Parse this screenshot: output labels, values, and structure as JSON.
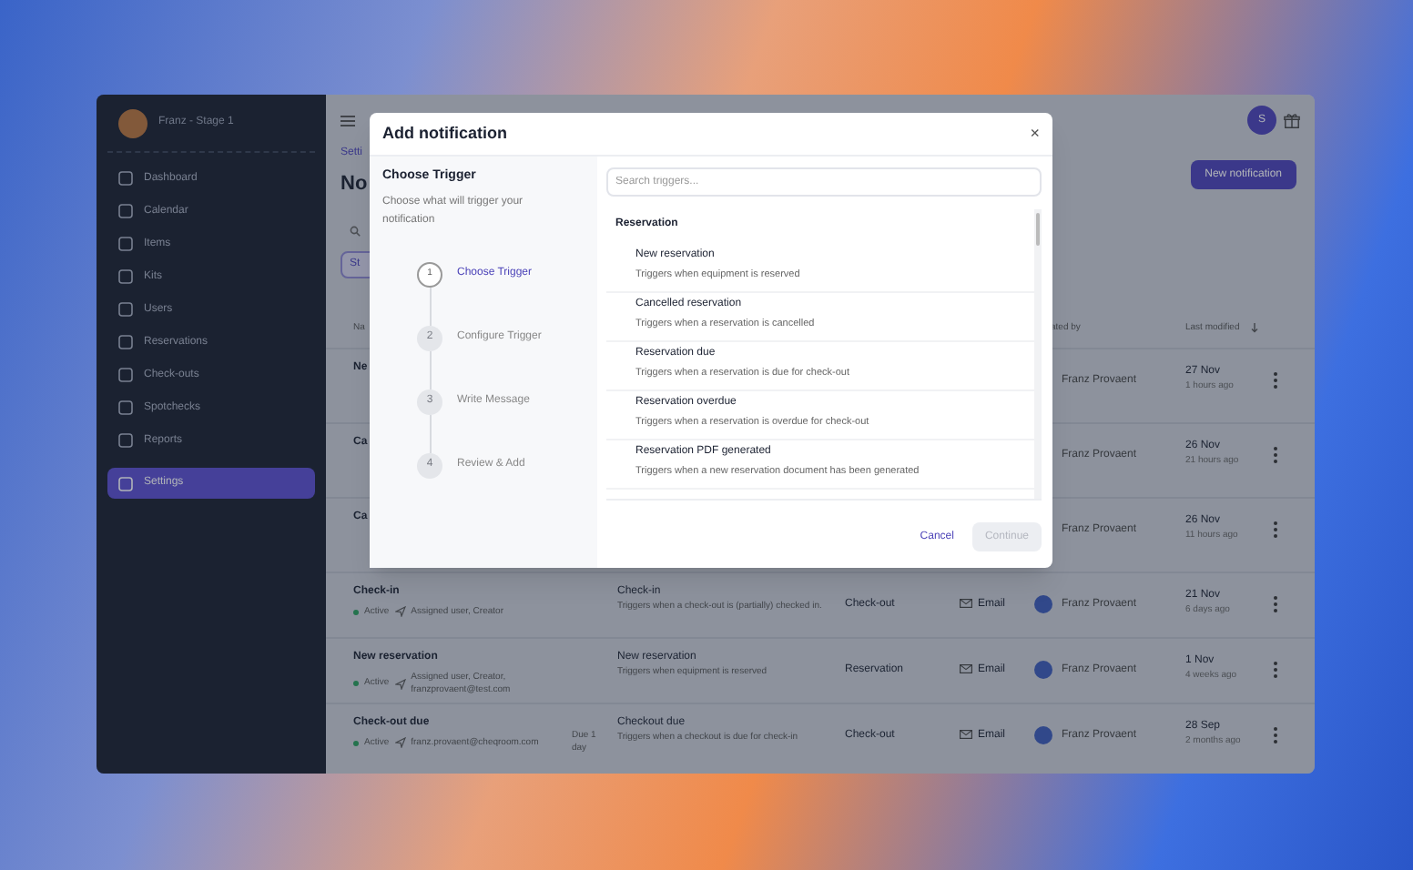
{
  "workspace": {
    "name": "Franz - Stage 1"
  },
  "sidebar": {
    "items": [
      {
        "label": "Dashboard",
        "selected": false
      },
      {
        "label": "Calendar",
        "selected": false
      },
      {
        "label": "Items",
        "selected": false
      },
      {
        "label": "Kits",
        "selected": false
      },
      {
        "label": "Users",
        "selected": false
      },
      {
        "label": "Reservations",
        "selected": false
      },
      {
        "label": "Check-outs",
        "selected": false
      },
      {
        "label": "Spotchecks",
        "selected": false
      },
      {
        "label": "Reports",
        "selected": false
      },
      {
        "label": "Settings",
        "selected": true
      }
    ]
  },
  "topbar": {
    "avatar": "S"
  },
  "page": {
    "breadcrumb": "Setti",
    "heading": "No",
    "filter": "St",
    "new_button": "New notification"
  },
  "table": {
    "columns": [
      {
        "label": "Na"
      },
      {
        "label": "ated by"
      },
      {
        "label": "Last modified",
        "sorted": true
      }
    ],
    "rows": [
      {
        "name": "Ne",
        "creator": "Franz Provaent",
        "date": "27 Nov",
        "ago": "1 hours ago"
      },
      {
        "name": "Ca",
        "creator": "Franz Provaent",
        "date": "26 Nov",
        "ago": "21 hours ago"
      },
      {
        "name": "Ca",
        "creator": "Franz Provaent",
        "date": "26 Nov",
        "ago": "11 hours ago"
      },
      {
        "name": "Check-in",
        "status": "Active",
        "recipients": "Assigned user, Creator",
        "trigger": "Check-in",
        "trigger_desc": "Triggers when a check-out is (partially) checked in.",
        "category": "Check-out",
        "channel": "Email",
        "creator": "Franz Provaent",
        "date": "21 Nov",
        "ago": "6 days ago"
      },
      {
        "name": "New reservation",
        "status": "Active",
        "recipients": "Assigned user, Creator, franzprovaent@test.com",
        "trigger": "New reservation",
        "trigger_desc": "Triggers when equipment is reserved",
        "category": "Reservation",
        "channel": "Email",
        "creator": "Franz Provaent",
        "date": "1 Nov",
        "ago": "4 weeks ago"
      },
      {
        "name": "Check-out due",
        "status": "Active",
        "recipients": "franz.provaent@cheqroom.com",
        "due": "Due 1 day",
        "trigger": "Checkout due",
        "trigger_desc": "Triggers when a checkout is due for check-in",
        "category": "Check-out",
        "channel": "Email",
        "creator": "Franz Provaent",
        "date": "28 Sep",
        "ago": "2 months ago"
      }
    ]
  },
  "modal": {
    "title": "Add notification",
    "close": "×",
    "section_title": "Choose Trigger",
    "section_desc": "Choose what will trigger your notification",
    "steps": [
      {
        "number": "1",
        "label": "Choose Trigger",
        "selected": true
      },
      {
        "number": "2",
        "label": "Configure Trigger",
        "selected": false
      },
      {
        "number": "3",
        "label": "Write Message",
        "selected": false
      },
      {
        "number": "4",
        "label": "Review & Add",
        "selected": false
      }
    ],
    "search": {
      "placeholder": "Search triggers..."
    },
    "group": "Reservation",
    "triggers": [
      {
        "title": "New reservation",
        "desc": "Triggers when equipment is reserved"
      },
      {
        "title": "Cancelled reservation",
        "desc": "Triggers when a reservation is cancelled"
      },
      {
        "title": "Reservation due",
        "desc": "Triggers when a reservation is due for check-out"
      },
      {
        "title": "Reservation overdue",
        "desc": "Triggers when a reservation is overdue for check-out"
      },
      {
        "title": "Reservation PDF generated",
        "desc": "Triggers when a new reservation document has been generated"
      }
    ],
    "cancel": "Cancel",
    "continue": {
      "label": "Continue",
      "disabled": true
    }
  }
}
